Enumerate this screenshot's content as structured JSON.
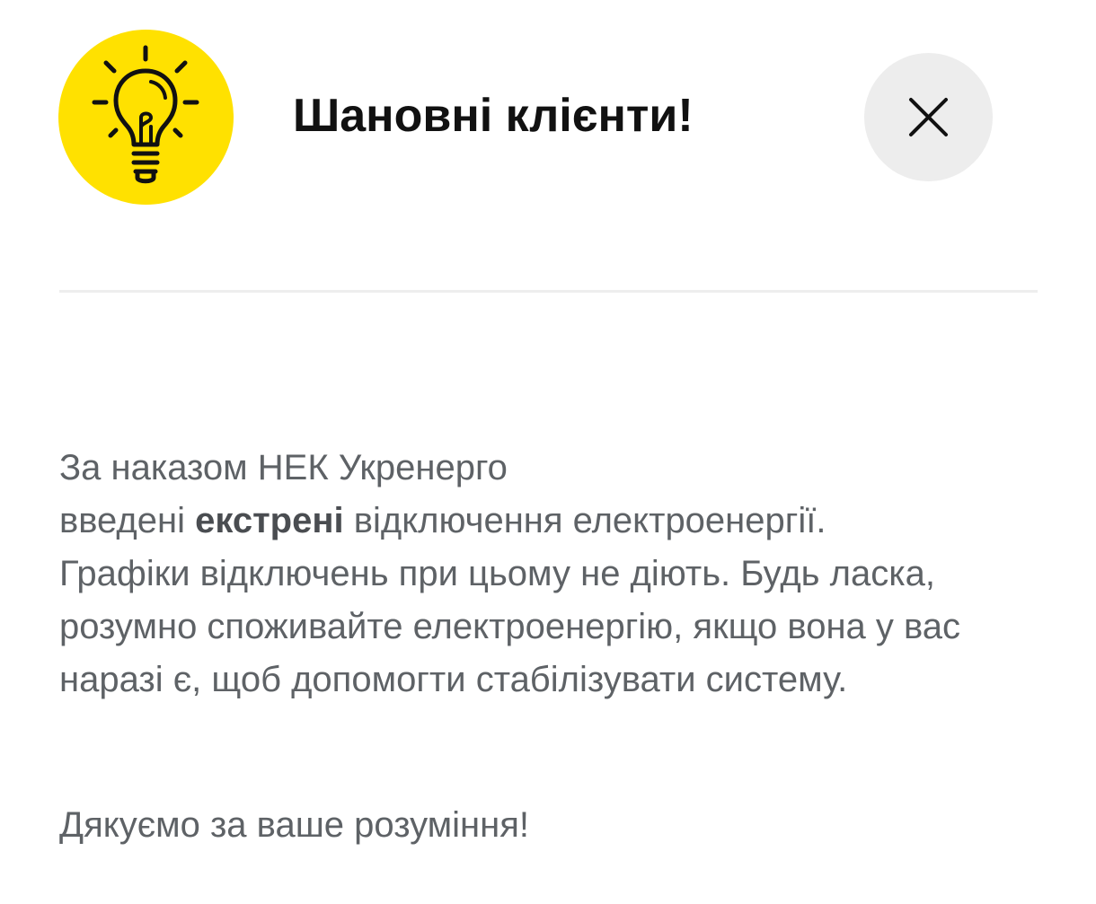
{
  "dialog": {
    "title": "Шановні клієнти!",
    "icon": "lightbulb-idea-icon",
    "close_icon": "close-icon",
    "accent_color": "#FFE100",
    "close_bg_color": "#EDEDED"
  },
  "message": {
    "line1": "За наказом НЕК Укренерго",
    "line2_prefix": "введені ",
    "line2_bold": "екстрені",
    "line2_suffix": " відключення електроенергії.",
    "line3": "Графіки відключень при цьому не діють.  Будь ласка, розумно споживайте електроенергію, якщо вона у вас наразі є, щоб допомогти стабілізувати систему.",
    "thanks": "Дякуємо за ваше розуміння!"
  }
}
